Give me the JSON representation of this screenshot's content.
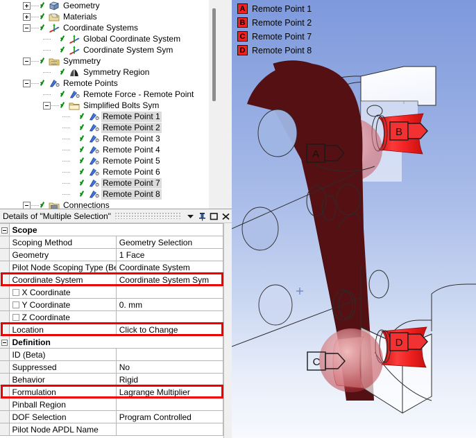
{
  "tree": {
    "name": "outline-tree",
    "items": [
      {
        "label": "Geometry",
        "depth": 1,
        "expander": "plus",
        "icon": "geometry-icon",
        "check": true,
        "selected": false
      },
      {
        "label": "Materials",
        "depth": 1,
        "expander": "plus",
        "icon": "materials-icon",
        "check": true,
        "selected": false
      },
      {
        "label": "Coordinate Systems",
        "depth": 1,
        "expander": "minus",
        "icon": "coord-systems-icon",
        "check": true,
        "selected": false
      },
      {
        "label": "Global Coordinate System",
        "depth": 2,
        "expander": "none",
        "icon": "coord-system-icon",
        "check": true,
        "selected": false
      },
      {
        "label": "Coordinate System Sym",
        "depth": 2,
        "expander": "none",
        "icon": "coord-system-icon",
        "check": true,
        "selected": false
      },
      {
        "label": "Symmetry",
        "depth": 1,
        "expander": "minus",
        "icon": "symmetry-folder-icon",
        "check": true,
        "selected": false
      },
      {
        "label": "Symmetry Region",
        "depth": 2,
        "expander": "none",
        "icon": "symmetry-region-icon",
        "check": true,
        "selected": false
      },
      {
        "label": "Remote Points",
        "depth": 1,
        "expander": "minus",
        "icon": "remote-point-icon",
        "check": true,
        "selected": false
      },
      {
        "label": "Remote Force - Remote Point",
        "depth": 2,
        "expander": "none",
        "icon": "remote-point-icon",
        "check": true,
        "selected": false
      },
      {
        "label": "Simplified Bolts Sym",
        "depth": 2,
        "expander": "minus",
        "icon": "folder-icon",
        "check": true,
        "selected": false
      },
      {
        "label": "Remote Point 1",
        "depth": 3,
        "expander": "none",
        "icon": "remote-point-icon",
        "check": true,
        "selected": true
      },
      {
        "label": "Remote Point 2",
        "depth": 3,
        "expander": "none",
        "icon": "remote-point-icon",
        "check": true,
        "selected": true
      },
      {
        "label": "Remote Point 3",
        "depth": 3,
        "expander": "none",
        "icon": "remote-point-icon",
        "check": true,
        "selected": false
      },
      {
        "label": "Remote Point 4",
        "depth": 3,
        "expander": "none",
        "icon": "remote-point-icon",
        "check": true,
        "selected": false
      },
      {
        "label": "Remote Point 5",
        "depth": 3,
        "expander": "none",
        "icon": "remote-point-icon",
        "check": true,
        "selected": false
      },
      {
        "label": "Remote Point 6",
        "depth": 3,
        "expander": "none",
        "icon": "remote-point-icon",
        "check": true,
        "selected": false
      },
      {
        "label": "Remote Point 7",
        "depth": 3,
        "expander": "none",
        "icon": "remote-point-icon",
        "check": true,
        "selected": true
      },
      {
        "label": "Remote Point 8",
        "depth": 3,
        "expander": "none",
        "icon": "remote-point-icon",
        "check": true,
        "selected": true
      },
      {
        "label": "Connections",
        "depth": 1,
        "expander": "minus",
        "icon": "connections-icon",
        "check": true,
        "selected": false
      }
    ]
  },
  "details": {
    "title": "Details of \"Multiple Selection\"",
    "titlebar_buttons": [
      {
        "name": "dropdown-arrow-icon",
        "glyph": "chevron-down"
      },
      {
        "name": "pin-icon",
        "glyph": "pin"
      },
      {
        "name": "maximize-icon",
        "glyph": "square"
      },
      {
        "name": "close-icon",
        "glyph": "x"
      }
    ],
    "rows": [
      {
        "type": "section",
        "property": "Scope",
        "value": "",
        "highlight": false,
        "checkbox": false
      },
      {
        "type": "property",
        "property": "Scoping Method",
        "value": "Geometry Selection",
        "highlight": false,
        "checkbox": false
      },
      {
        "type": "property",
        "property": "Geometry",
        "value": "1 Face",
        "highlight": false,
        "checkbox": false
      },
      {
        "type": "property",
        "property": "Pilot Node Scoping Type (Beta)",
        "value": "Coordinate System",
        "highlight": false,
        "checkbox": false
      },
      {
        "type": "property",
        "property": "Coordinate System",
        "value": "Coordinate System Sym",
        "highlight": true,
        "checkbox": false
      },
      {
        "type": "property",
        "property": "X Coordinate",
        "value": "",
        "highlight": false,
        "checkbox": true
      },
      {
        "type": "property",
        "property": "Y Coordinate",
        "value": "0. mm",
        "highlight": false,
        "checkbox": true
      },
      {
        "type": "property",
        "property": "Z Coordinate",
        "value": "",
        "highlight": false,
        "checkbox": true
      },
      {
        "type": "property",
        "property": "Location",
        "value": "Click to Change",
        "highlight": true,
        "checkbox": false
      },
      {
        "type": "section",
        "property": "Definition",
        "value": "",
        "highlight": false,
        "checkbox": false
      },
      {
        "type": "property",
        "property": "ID (Beta)",
        "value": "",
        "highlight": false,
        "checkbox": false
      },
      {
        "type": "property",
        "property": "Suppressed",
        "value": "No",
        "highlight": false,
        "checkbox": false
      },
      {
        "type": "property",
        "property": "Behavior",
        "value": "Rigid",
        "highlight": false,
        "checkbox": false
      },
      {
        "type": "property",
        "property": "Formulation",
        "value": "Lagrange Multiplier",
        "highlight": true,
        "checkbox": false
      },
      {
        "type": "property",
        "property": "Pinball Region",
        "value": "",
        "highlight": false,
        "checkbox": false
      },
      {
        "type": "property",
        "property": "DOF Selection",
        "value": "Program Controlled",
        "highlight": false,
        "checkbox": false
      },
      {
        "type": "property",
        "property": "Pilot Node APDL Name",
        "value": "",
        "highlight": false,
        "checkbox": false
      }
    ]
  },
  "viewport": {
    "name": "graphics-viewport",
    "legend": [
      {
        "badge": "A",
        "label": "Remote Point 1"
      },
      {
        "badge": "B",
        "label": "Remote Point 2"
      },
      {
        "badge": "C",
        "label": "Remote Point 7"
      },
      {
        "badge": "D",
        "label": "Remote Point 8"
      }
    ],
    "scene_tags": [
      {
        "badge": "A",
        "style": "outline"
      },
      {
        "badge": "B",
        "style": "filled"
      },
      {
        "badge": "C",
        "style": "outline"
      },
      {
        "badge": "D",
        "style": "filled"
      }
    ]
  },
  "colors": {
    "highlight_red": "#ee0000",
    "badge_red": "#f52020",
    "selection_gray": "#dcdcdc",
    "part_maroon": "#551013",
    "face_red": "#e61b1b",
    "viewport_top": "#7e9add",
    "viewport_bottom": "#f7f9fd"
  }
}
